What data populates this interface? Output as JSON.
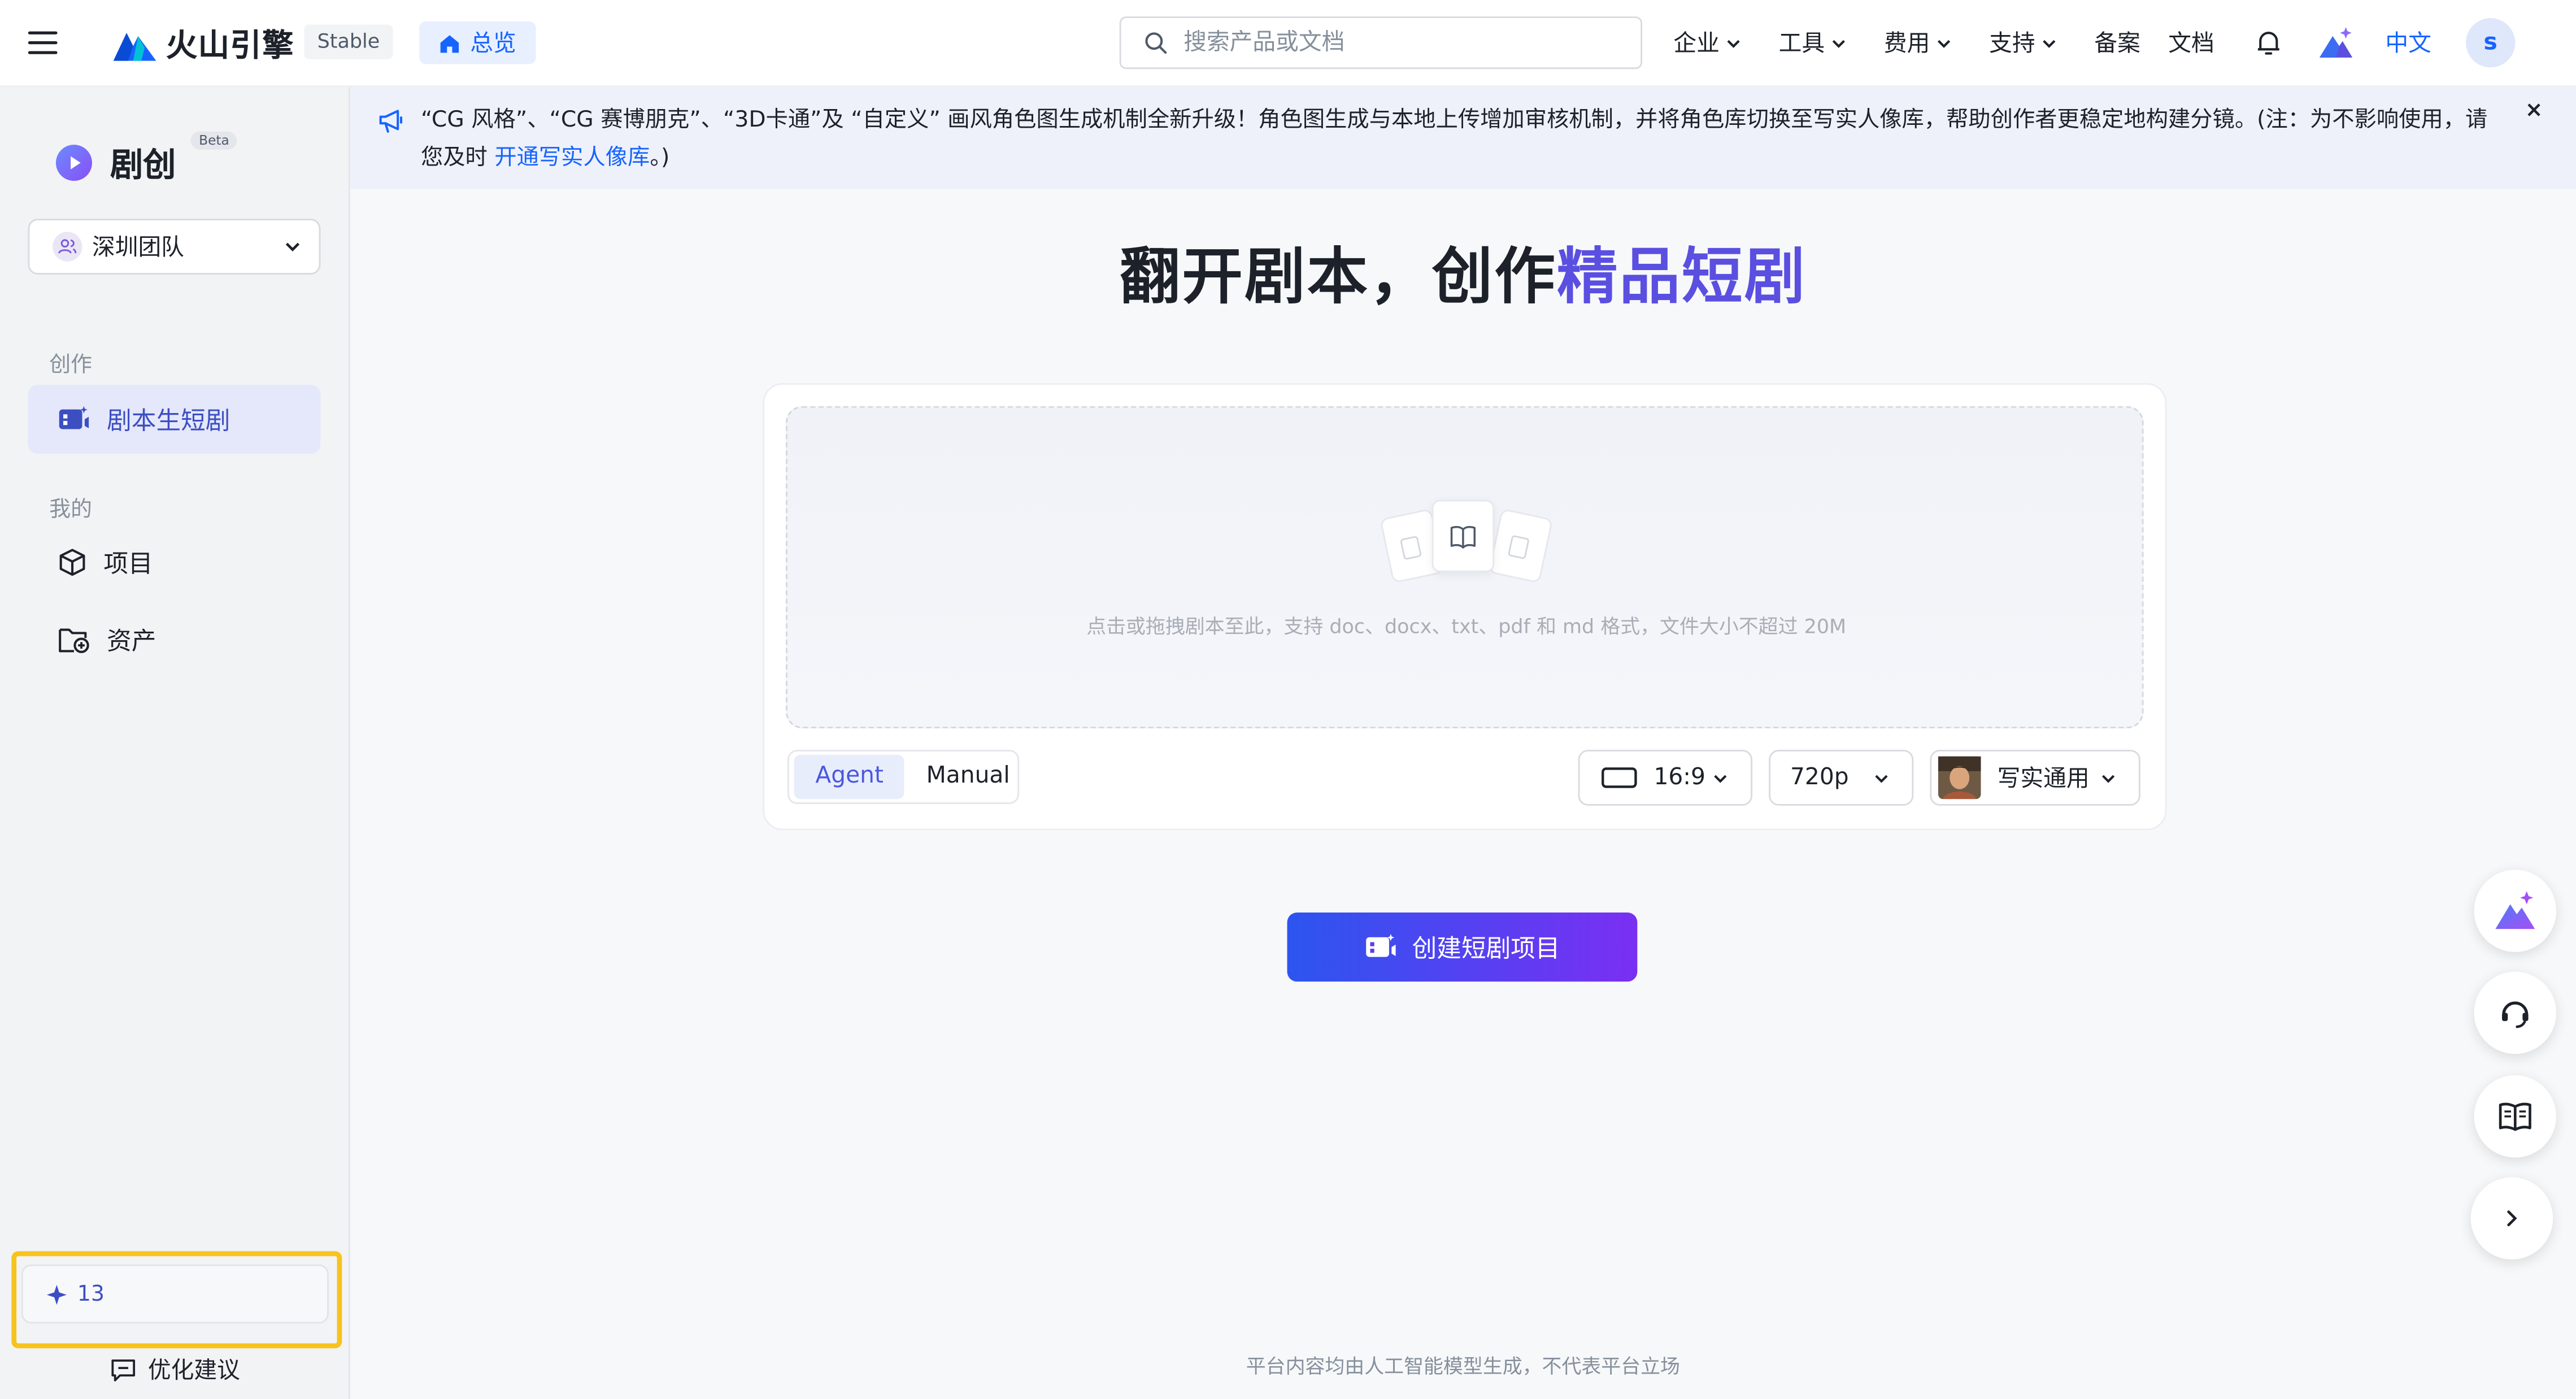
{
  "topbar": {
    "brand": "火山引擎",
    "env_badge": "Stable",
    "overview_tab": "总览",
    "search_placeholder": "搜索产品或文档",
    "nav": [
      {
        "label": "企业",
        "has_dropdown": true
      },
      {
        "label": "工具",
        "has_dropdown": true
      },
      {
        "label": "费用",
        "has_dropdown": true
      },
      {
        "label": "支持",
        "has_dropdown": true
      },
      {
        "label": "备案",
        "has_dropdown": false
      },
      {
        "label": "文档",
        "has_dropdown": false
      }
    ],
    "language": "中文",
    "avatar_initial": "s"
  },
  "sidebar": {
    "app_name": "剧创",
    "beta_badge": "Beta",
    "team_selector": "深圳团队",
    "section_create": "创作",
    "item_script_to_drama": "剧本生短剧",
    "section_mine": "我的",
    "item_projects": "项目",
    "item_assets": "资产",
    "credits": "13",
    "feedback": "优化建议"
  },
  "notice": {
    "text_before_link": "“CG 风格”、“CG 赛博朋克”、“3D卡通”及 “自定义” 画风角色图生成机制全新升级！角色图生成与本地上传增加审核机制，并将角色库切换至写实人像库，帮助创作者更稳定地构建分镜。(注：为不影响使用，请您及时 ",
    "link_text": "开通写实人像库",
    "text_after_link": "。)",
    "close": "×"
  },
  "main": {
    "headline_part1": "翻开剧本，创作",
    "headline_part2": "精品短剧",
    "upload_hint": "点击或拖拽剧本至此，支持 doc、docx、txt、pdf 和 md 格式，文件大小不超过 20M",
    "mode_agent": "Agent",
    "mode_manual": "Manual",
    "selected_mode": "Agent",
    "aspect_ratio": "16:9",
    "resolution": "720p",
    "style": "写实通用",
    "create_button": "创建短剧项目"
  },
  "footer": {
    "disclaimer": "平台内容均由人工智能模型生成，不代表平台立场"
  },
  "colors": {
    "accent": "#5a4fe0",
    "link": "#1664ff",
    "create_gradient_start": "#2c55f0",
    "create_gradient_end": "#7a2ff2",
    "highlight_border": "#f7c31d"
  },
  "icons": {
    "menu": "hamburger-icon",
    "search": "search-icon",
    "bell": "bell-icon",
    "notice": "megaphone-icon",
    "float_buttons": [
      "assistant-logo-icon",
      "headset-icon",
      "book-icon",
      "chevron-right-icon"
    ]
  }
}
